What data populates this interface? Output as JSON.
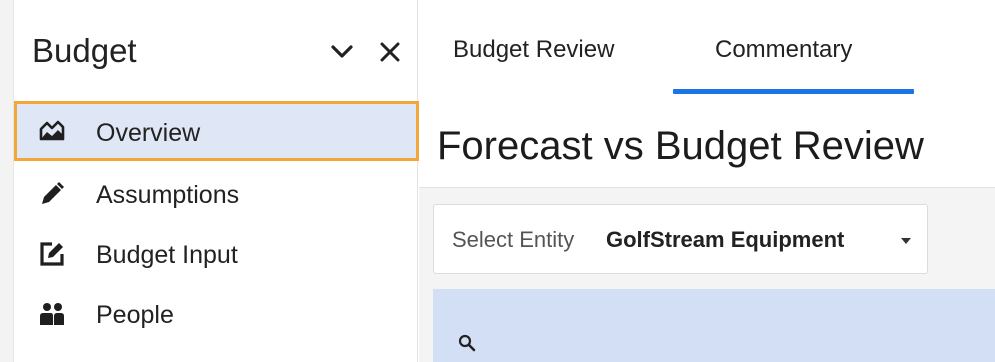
{
  "sidebar": {
    "title": "Budget",
    "collapse_icon": "chevron-down-icon",
    "close_icon": "close-icon",
    "items": [
      {
        "label": "Overview",
        "icon": "overview-chart-icon",
        "active": true
      },
      {
        "label": "Assumptions",
        "icon": "pencil-icon",
        "active": false
      },
      {
        "label": "Budget Input",
        "icon": "edit-box-icon",
        "active": false
      },
      {
        "label": "People",
        "icon": "people-icon",
        "active": false
      }
    ],
    "active_highlight_color": "#f2a73b"
  },
  "main": {
    "tabs": [
      {
        "label": "Budget Review",
        "active": false
      },
      {
        "label": "Commentary",
        "active": true
      }
    ],
    "active_tab_color": "#1a73e8",
    "page_title": "Forecast vs Budget Review",
    "entity_selector": {
      "label": "Select Entity",
      "value": "GolfStream Equipment"
    },
    "search_icon": "search-icon"
  }
}
